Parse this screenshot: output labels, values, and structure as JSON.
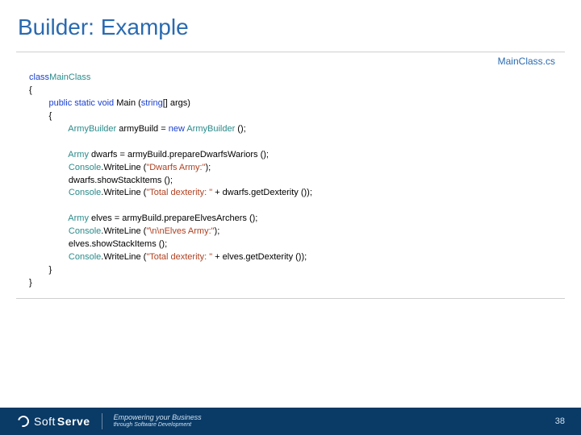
{
  "title": "Builder: Example",
  "filename": "MainClass.cs",
  "code_tokens": [
    [
      [
        "kw",
        "class"
      ],
      [
        "",
        ""
      ],
      [
        "type",
        "MainClass"
      ]
    ],
    [
      [
        "",
        "{"
      ]
    ],
    [
      [
        "",
        "        "
      ],
      [
        "kw",
        "public static void"
      ],
      [
        "",
        " Main ("
      ],
      [
        "kw",
        "string"
      ],
      [
        "",
        "[] args)"
      ]
    ],
    [
      [
        "",
        "        {"
      ]
    ],
    [
      [
        "",
        "                "
      ],
      [
        "type",
        "ArmyBuilder"
      ],
      [
        "",
        " armyBuild = "
      ],
      [
        "kw",
        "new"
      ],
      [
        "",
        ""
      ],
      [
        "type",
        " ArmyBuilder"
      ],
      [
        "",
        " ();"
      ]
    ],
    [
      [
        "",
        ""
      ]
    ],
    [
      [
        "",
        "                "
      ],
      [
        "type",
        "Army"
      ],
      [
        "",
        " dwarfs = armyBuild.prepareDwarfsWariors ();"
      ]
    ],
    [
      [
        "",
        "                "
      ],
      [
        "type",
        "Console"
      ],
      [
        "",
        ".WriteLine ("
      ],
      [
        "str",
        "\"Dwarfs Army:\""
      ],
      [
        "",
        ");"
      ]
    ],
    [
      [
        "",
        "                dwarfs.showStackItems ();"
      ]
    ],
    [
      [
        "",
        "                "
      ],
      [
        "type",
        "Console"
      ],
      [
        "",
        ".WriteLine ("
      ],
      [
        "str",
        "\"Total dexterity: \""
      ],
      [
        "",
        " + dwarfs.getDexterity ());"
      ]
    ],
    [
      [
        "",
        ""
      ]
    ],
    [
      [
        "",
        "                "
      ],
      [
        "type",
        "Army"
      ],
      [
        "",
        " elves = armyBuild.prepareElvesArchers ();"
      ]
    ],
    [
      [
        "",
        "                "
      ],
      [
        "type",
        "Console"
      ],
      [
        "",
        ".WriteLine ("
      ],
      [
        "str",
        "\"\\n\\nElves Army:\""
      ],
      [
        "",
        ");"
      ]
    ],
    [
      [
        "",
        "                elves.showStackItems ();"
      ]
    ],
    [
      [
        "",
        "                "
      ],
      [
        "type",
        "Console"
      ],
      [
        "",
        ".WriteLine ("
      ],
      [
        "str",
        "\"Total dexterity: \""
      ],
      [
        "",
        " + elves.getDexterity ());"
      ]
    ],
    [
      [
        "",
        "        }"
      ]
    ],
    [
      [
        "",
        "}"
      ]
    ]
  ],
  "footer": {
    "brand_prefix": "Soft",
    "brand_suffix": "Serve",
    "tagline_line1": "Empowering your Business",
    "tagline_line2": "through Software Development"
  },
  "page_number": "38"
}
